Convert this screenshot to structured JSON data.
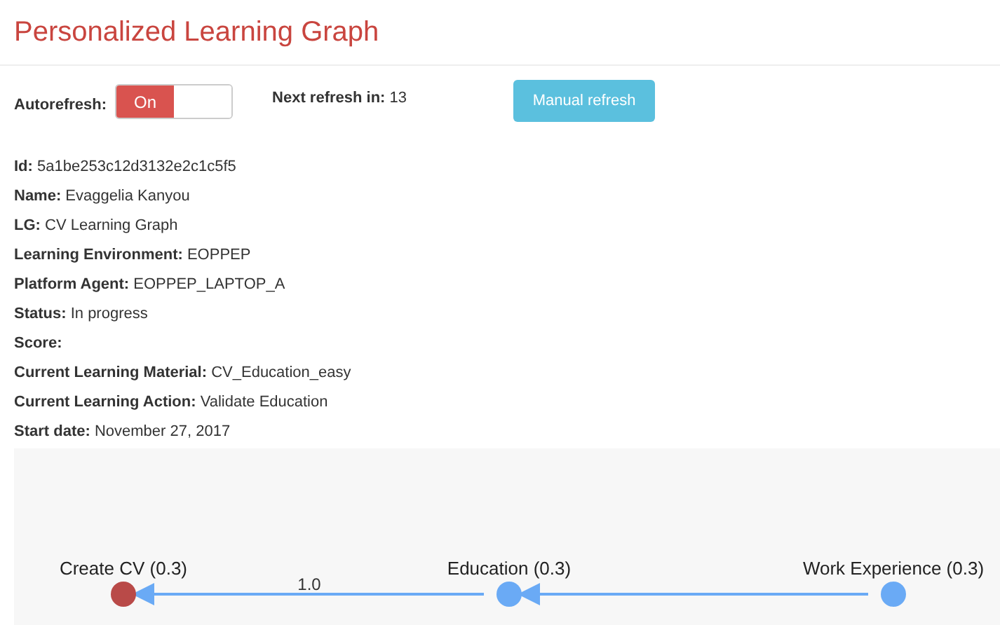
{
  "title": "Personalized Learning Graph",
  "autorefresh": {
    "label": "Autorefresh:",
    "toggle_text": "On",
    "on": true
  },
  "next_refresh": {
    "label": "Next refresh in:",
    "value": "13"
  },
  "manual_refresh_button": "Manual refresh",
  "fields": [
    {
      "label": "Id:",
      "value": "5a1be253c12d3132e2c1c5f5"
    },
    {
      "label": "Name:",
      "value": "Evaggelia Kanyou"
    },
    {
      "label": "LG:",
      "value": "CV Learning Graph"
    },
    {
      "label": "Learning Environment:",
      "value": "EOPPEP"
    },
    {
      "label": "Platform Agent:",
      "value": "EOPPEP_LAPTOP_A"
    },
    {
      "label": "Status:",
      "value": "In progress"
    },
    {
      "label": "Score:"
    },
    {
      "label": "Current Learning Material:",
      "value": "CV_Education_easy"
    },
    {
      "label": "Current Learning Action:",
      "value": "Validate Education"
    },
    {
      "label": "Start date:",
      "value": "November 27, 2017"
    }
  ],
  "graph": {
    "nodes": [
      {
        "label": "Create CV (0.3)",
        "color": "#b94a48"
      },
      {
        "label": "Education (0.3)",
        "color": "#6aaaf5"
      },
      {
        "label": "Work Experience (0.3)",
        "color": "#6aaaf5"
      }
    ],
    "edge_labels": [
      "1.0"
    ]
  }
}
